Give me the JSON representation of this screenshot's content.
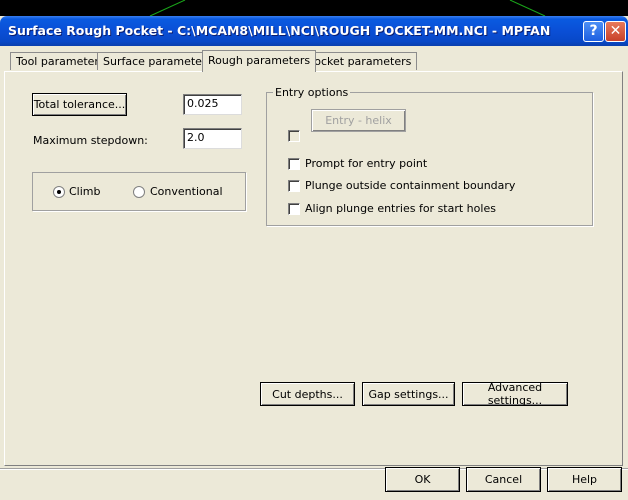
{
  "window": {
    "title": "Surface Rough Pocket - C:\\MCAM8\\MILL\\NCI\\ROUGH POCKET-MM.NCI - MPFAN",
    "help_glyph": "?",
    "close_glyph": "✕"
  },
  "tabs": [
    {
      "label": "Tool parameters",
      "active": false
    },
    {
      "label": "Surface parameters",
      "active": false
    },
    {
      "label": "Rough parameters",
      "active": true
    },
    {
      "label": "Pocket parameters",
      "active": false
    }
  ],
  "rough": {
    "total_tolerance_label": "Total tolerance...",
    "total_tolerance_value": "0.025",
    "max_stepdown_label": "Maximum stepdown:",
    "max_stepdown_value": "2.0",
    "direction": {
      "climb_label": "Climb",
      "conventional_label": "Conventional",
      "selected": "climb"
    }
  },
  "entry_options": {
    "title": "Entry options",
    "entry_helix_label": "Entry - helix",
    "entry_helix_checked": false,
    "prompt_label": "Prompt for entry point",
    "plunge_outside_label": "Plunge outside containment boundary",
    "align_plunge_label": "Align plunge entries for start holes"
  },
  "action_buttons": {
    "cut_depths": "Cut depths...",
    "gap_settings": "Gap settings...",
    "advanced_settings": "Advanced settings..."
  },
  "footer": {
    "ok": "OK",
    "cancel": "Cancel",
    "help": "Help"
  },
  "colors": {
    "dialog_bg": "#ece9d8",
    "title_blue": "#0a4fd6",
    "close_red": "#c8402a"
  }
}
